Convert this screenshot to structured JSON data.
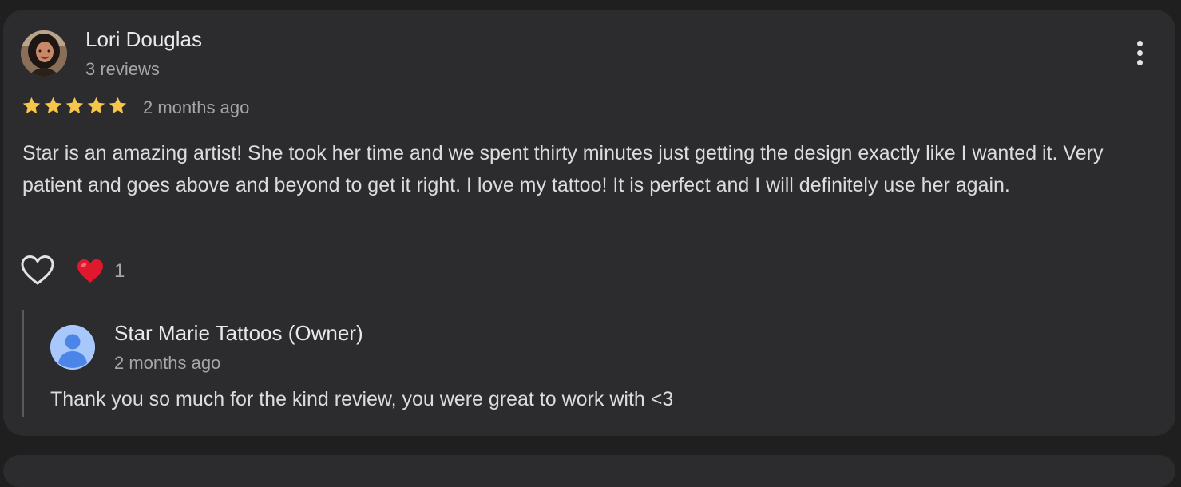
{
  "review": {
    "reviewer_name": "Lori Douglas",
    "reviewer_meta": "3 reviews",
    "rating": 5,
    "date": "2 months ago",
    "text": "Star is an amazing artist! She took her time and we spent thirty minutes just getting the design exactly like I wanted it. Very patient and goes above and beyond to get it right. I love my tattoo! It is perfect and I will definitely use her again.",
    "reaction_emoji": "heart-emoji",
    "reaction_count": "1"
  },
  "reply": {
    "owner_name": "Star Marie Tattoos (Owner)",
    "date": "2 months ago",
    "text": "Thank you so much for the kind review, you were great to work with <3"
  },
  "colors": {
    "background": "#1f1f20",
    "card": "#2c2c2e",
    "star": "#f6c64a",
    "heart": "#e0182e",
    "owner_avatar": "#a8c7fa",
    "owner_avatar_figure": "#4b85e8"
  },
  "icons": [
    "more-vert-icon",
    "star-icon",
    "heart-outline-icon",
    "heart-emoji",
    "person-icon"
  ]
}
